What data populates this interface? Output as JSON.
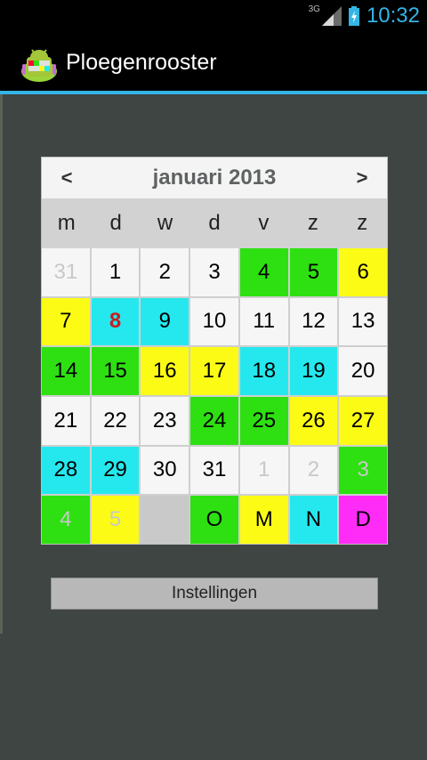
{
  "status_bar": {
    "network_type": "3G",
    "time": "10:32",
    "icons": [
      "signal-icon",
      "battery-charging-icon"
    ],
    "accent_color": "#33b5e5"
  },
  "action_bar": {
    "title": "Ploegenrooster",
    "icon": "android-app-icon"
  },
  "calendar": {
    "prev_label": "<",
    "next_label": ">",
    "month_title": "januari 2013",
    "weekdays": [
      "m",
      "d",
      "w",
      "d",
      "v",
      "z",
      "z"
    ],
    "colors": {
      "white": "#f6f6f6",
      "green": "#2ee012",
      "yellow": "#fbfb16",
      "cyan": "#25e8ee",
      "magenta": "#ff2cf7",
      "empty": "#c9c9c9"
    },
    "cells": [
      {
        "label": "31",
        "color": "w",
        "muted": true
      },
      {
        "label": "1",
        "color": "w"
      },
      {
        "label": "2",
        "color": "w"
      },
      {
        "label": "3",
        "color": "w"
      },
      {
        "label": "4",
        "color": "g"
      },
      {
        "label": "5",
        "color": "g"
      },
      {
        "label": "6",
        "color": "y"
      },
      {
        "label": "7",
        "color": "y"
      },
      {
        "label": "8",
        "color": "c",
        "today": true
      },
      {
        "label": "9",
        "color": "c"
      },
      {
        "label": "10",
        "color": "w"
      },
      {
        "label": "11",
        "color": "w"
      },
      {
        "label": "12",
        "color": "w"
      },
      {
        "label": "13",
        "color": "w"
      },
      {
        "label": "14",
        "color": "g"
      },
      {
        "label": "15",
        "color": "g"
      },
      {
        "label": "16",
        "color": "y"
      },
      {
        "label": "17",
        "color": "y"
      },
      {
        "label": "18",
        "color": "c"
      },
      {
        "label": "19",
        "color": "c"
      },
      {
        "label": "20",
        "color": "w"
      },
      {
        "label": "21",
        "color": "w"
      },
      {
        "label": "22",
        "color": "w"
      },
      {
        "label": "23",
        "color": "w"
      },
      {
        "label": "24",
        "color": "g"
      },
      {
        "label": "25",
        "color": "g"
      },
      {
        "label": "26",
        "color": "y"
      },
      {
        "label": "27",
        "color": "y"
      },
      {
        "label": "28",
        "color": "c"
      },
      {
        "label": "29",
        "color": "c"
      },
      {
        "label": "30",
        "color": "w"
      },
      {
        "label": "31",
        "color": "w"
      },
      {
        "label": "1",
        "color": "w",
        "muted": true
      },
      {
        "label": "2",
        "color": "w",
        "muted": true
      },
      {
        "label": "3",
        "color": "g",
        "muted": true
      },
      {
        "label": "4",
        "color": "g",
        "muted": true
      },
      {
        "label": "5",
        "color": "y",
        "muted": true
      },
      {
        "label": "",
        "color": "e"
      },
      {
        "label": "O",
        "color": "g"
      },
      {
        "label": "M",
        "color": "y"
      },
      {
        "label": "N",
        "color": "c"
      },
      {
        "label": "D",
        "color": "m"
      }
    ]
  },
  "settings_button": {
    "label": "Instellingen"
  }
}
